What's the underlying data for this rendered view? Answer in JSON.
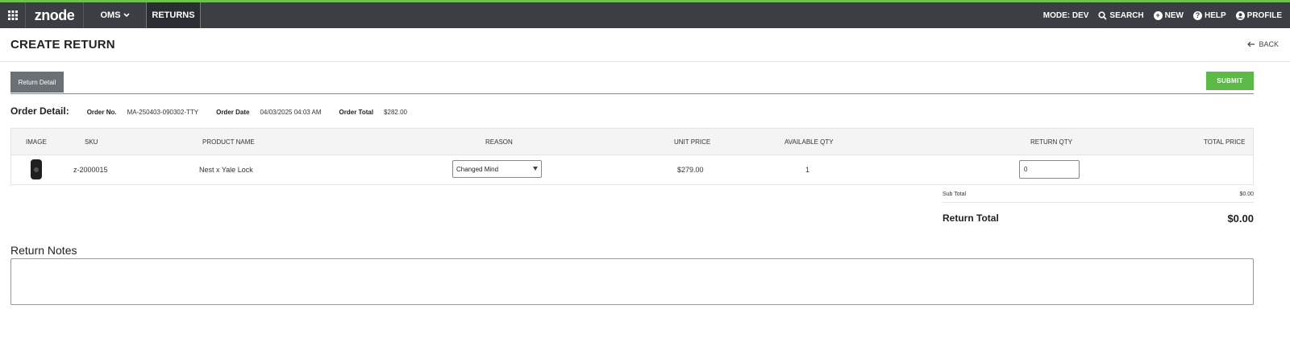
{
  "topbar": {
    "logo": "znode",
    "oms_label": "OMS",
    "returns_label": "RETURNS",
    "mode_label": "MODE: DEV",
    "search_label": "SEARCH",
    "new_label": "NEW",
    "help_label": "HELP",
    "profile_label": "PROFILE",
    "icons": [
      "apps-grid-icon",
      "chevron-down-icon",
      "search-icon",
      "plus-circle-icon",
      "help-circle-icon",
      "profile-icon"
    ]
  },
  "page": {
    "title": "CREATE RETURN",
    "back_label": "BACK",
    "tab_label": "Return Detail",
    "submit_label": "SUBMIT"
  },
  "order": {
    "heading": "Order Detail:",
    "order_no_label": "Order No.",
    "order_no": "MA-250403-090302-TTY",
    "order_date_label": "Order Date",
    "order_date": "04/03/2025 04:03 AM",
    "order_total_label": "Order Total",
    "order_total": "$282.00"
  },
  "table": {
    "headers": {
      "image": "IMAGE",
      "sku": "SKU",
      "product": "PRODUCT NAME",
      "reason": "REASON",
      "unit_price": "UNIT PRICE",
      "available_qty": "AVAILABLE QTY",
      "return_qty": "RETURN QTY",
      "total_price": "TOTAL PRICE"
    },
    "rows": [
      {
        "sku": "z-2000015",
        "product": "Nest x Yale Lock",
        "reason": "Changed Mind",
        "unit_price": "$279.00",
        "available_qty": "1",
        "return_qty": "0"
      }
    ]
  },
  "totals": {
    "subtotal_label": "Sub Total",
    "subtotal": "$0.00",
    "return_total_label": "Return Total",
    "return_total": "$0.00"
  },
  "notes": {
    "title": "Return Notes",
    "value": ""
  },
  "colors": {
    "topbar_bg": "#3b3f44",
    "accent_green": "#6cc24a",
    "submit_green": "#5db947",
    "tab_bg": "#6b7077"
  }
}
